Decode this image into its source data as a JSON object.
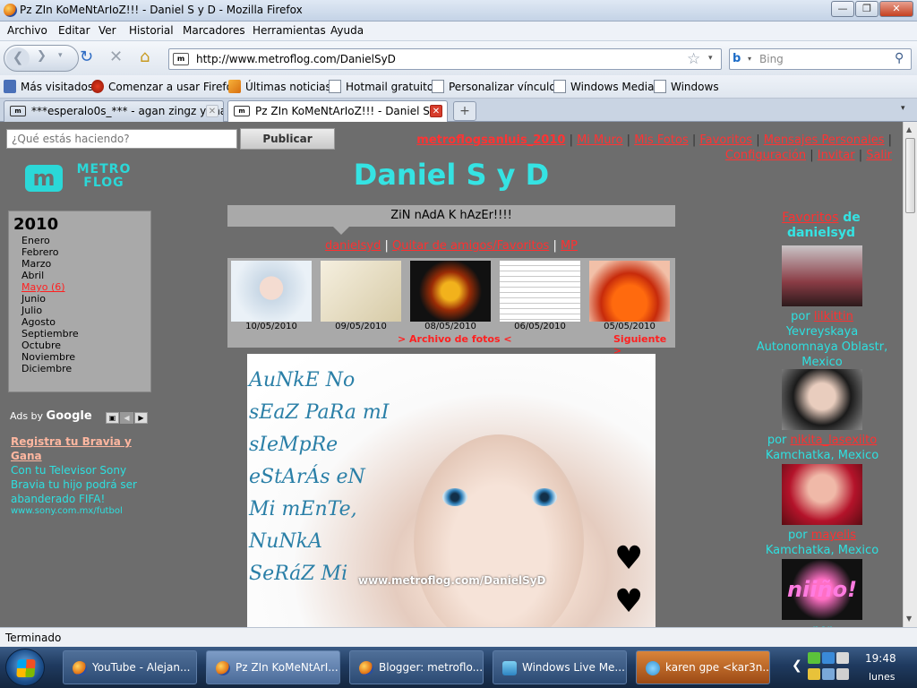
{
  "window": {
    "title": "Pz ZIn KoMeNtArIoZ!!! - Daniel S y D - Mozilla Firefox"
  },
  "menu": [
    "Archivo",
    "Editar",
    "Ver",
    "Historial",
    "Marcadores",
    "Herramientas",
    "Ayuda"
  ],
  "address": {
    "url": "http://www.metroflog.com/DanielSyD",
    "search_placeholder": "Bing"
  },
  "bookmarks": [
    "Más visitados",
    "Comenzar a usar Firefox",
    "Últimas noticias",
    "Hotmail gratuito",
    "Personalizar vínculos",
    "Windows Media",
    "Windows"
  ],
  "tabs": [
    {
      "label": "***esperalo0s_*** - agan zingz y ma...",
      "active": false
    },
    {
      "label": "Pz ZIn KoMeNtArIoZ!!! - Daniel S ...",
      "active": true
    }
  ],
  "page": {
    "status_placeholder": "¿Qué estás haciendo?",
    "publish_label": "Publicar",
    "top_links": {
      "user": "metroflogsanluis_2010",
      "items": [
        "Mi Muro",
        "Mis Fotos",
        "Favoritos",
        "Mensajes Personales",
        "Configuración",
        "Invitar",
        "Salir"
      ]
    },
    "logo_text": "METRO FLOG",
    "logo_mark": "m",
    "archive": {
      "year": "2010",
      "months": [
        "Enero",
        "Febrero",
        "Marzo",
        "Abril",
        "Mayo (6)",
        "Junio",
        "Julio",
        "Agosto",
        "Septiembre",
        "Octubre",
        "Noviembre",
        "Diciembre"
      ],
      "active_month": "Mayo (6)"
    },
    "ads": {
      "label_prefix": "Ads by",
      "label_brand": "Google",
      "headline": "Registra tu Bravia y Gana",
      "body": "Con tu Televisor Sony Bravia tu hijo podrá ser abanderado FIFA!",
      "url": "www.sony.com.mx/futbol"
    },
    "site_title": "Daniel S y D",
    "mood": "ZiN nAdA K hAzEr!!!!",
    "user_links": [
      "danielsyd",
      "Quitar de amigos/Favoritos",
      "MP"
    ],
    "thumbs": [
      {
        "date": "10/05/2010"
      },
      {
        "date": "09/05/2010"
      },
      {
        "date": "08/05/2010"
      },
      {
        "date": "06/05/2010"
      },
      {
        "date": "05/05/2010"
      }
    ],
    "archive_link": "> Archivo de fotos <",
    "next_link": "Siguiente >",
    "photo": {
      "lines": [
        "AuNkE No",
        "sEaZ PaRa mI",
        "sIeMpRe",
        "eStArÁs eN",
        "Mi mEnTe,",
        "NuNkA",
        "SeRáZ Mi"
      ],
      "watermark": "www.metroflog.com/DanielSyD"
    },
    "favorites": {
      "heading_link": "Favoritos",
      "heading_rest": "de danielsyd",
      "items": [
        {
          "by_prefix": "por",
          "user": "lilkittin",
          "location": "Yevreyskaya Autonomnaya Oblastr, Mexico"
        },
        {
          "by_prefix": "por",
          "user": "nikita_lasexiito",
          "location": "Kamchatka, Mexico"
        },
        {
          "by_prefix": "por",
          "user": "mayelis",
          "location": "Kamchatka, Mexico"
        },
        {
          "by_prefix": "por",
          "user": "",
          "location": "",
          "pic_text": "niiño!"
        }
      ]
    }
  },
  "statusbar": "Terminado",
  "taskbar": {
    "items": [
      {
        "label": "YouTube - Alejan...",
        "icon": "firefox-icon"
      },
      {
        "label": "Pz ZIn KoMeNtArI...",
        "icon": "firefox-icon"
      },
      {
        "label": "Blogger: metroflo...",
        "icon": "firefox-icon"
      },
      {
        "label": "Windows Live Me...",
        "icon": "windows-live-icon"
      },
      {
        "label": "karen gpe <kar3n...",
        "icon": "messenger-icon"
      }
    ],
    "time": "19:48",
    "day": "lunes"
  }
}
